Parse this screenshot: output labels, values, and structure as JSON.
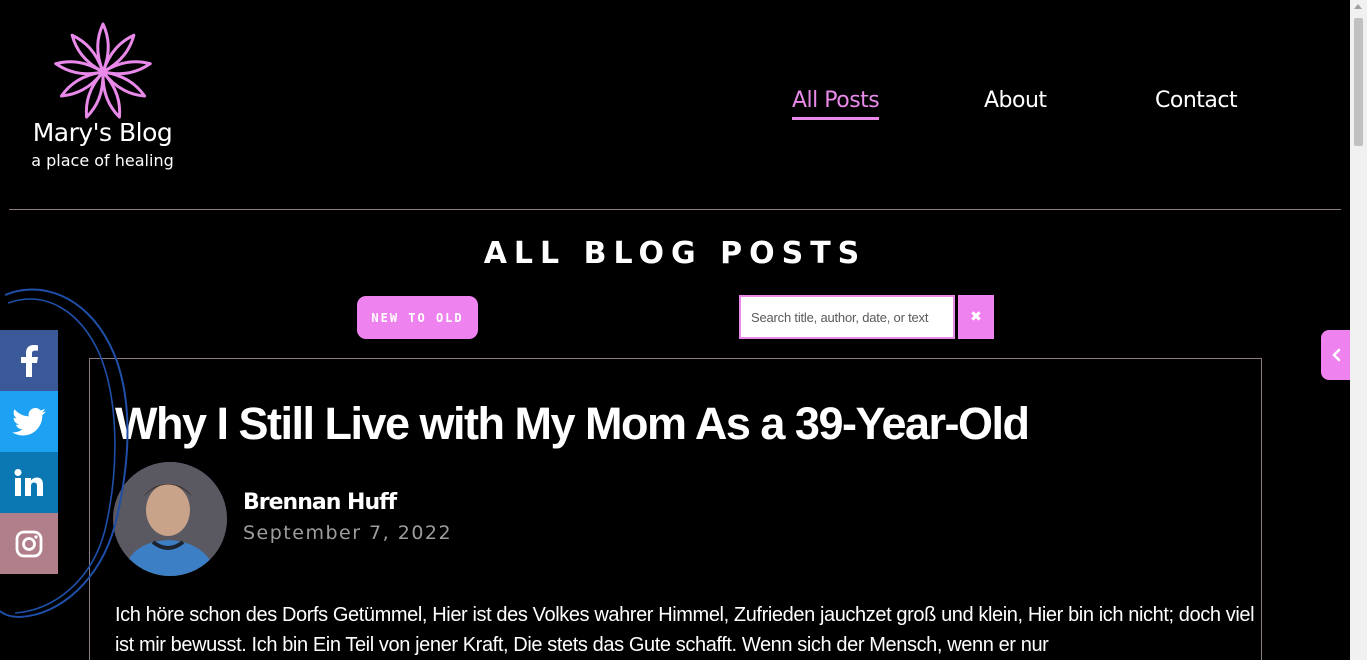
{
  "site": {
    "title": "Mary's Blog",
    "tagline": "a place of healing",
    "logo_icon": "lotus-flower-icon",
    "accent_color": "#ee82ee"
  },
  "nav": {
    "items": [
      {
        "label": "All Posts",
        "active": true
      },
      {
        "label": "About",
        "active": false
      },
      {
        "label": "Contact",
        "active": false
      }
    ]
  },
  "page": {
    "title": "ALL BLOG POSTS"
  },
  "controls": {
    "sort_label": "NEW TO OLD",
    "search_placeholder": "Search title, author, date, or text",
    "clear_icon": "close-icon",
    "side_tab_icon": "chevron-left-icon"
  },
  "social": [
    {
      "name": "facebook",
      "icon": "facebook-icon",
      "color": "#3b5998"
    },
    {
      "name": "twitter",
      "icon": "twitter-icon",
      "color": "#1da1f2"
    },
    {
      "name": "linkedin",
      "icon": "linkedin-icon",
      "color": "#0b77b3"
    },
    {
      "name": "instagram",
      "icon": "instagram-icon",
      "color": "#b07f8a"
    }
  ],
  "post": {
    "title": "Why I Still Live with My Mom As a 39-Year-Old",
    "author": "Brennan Huff",
    "date": "September 7, 2022",
    "excerpt": "Ich höre schon des Dorfs Getümmel, Hier ist des Volkes wahrer Himmel, Zufrieden jauchzet groß und klein, Hier bin ich nicht; doch viel ist mir bewusst. Ich bin Ein Teil von jener Kraft, Die stets das Gute schafft. Wenn sich der Mensch, wenn er nur"
  }
}
